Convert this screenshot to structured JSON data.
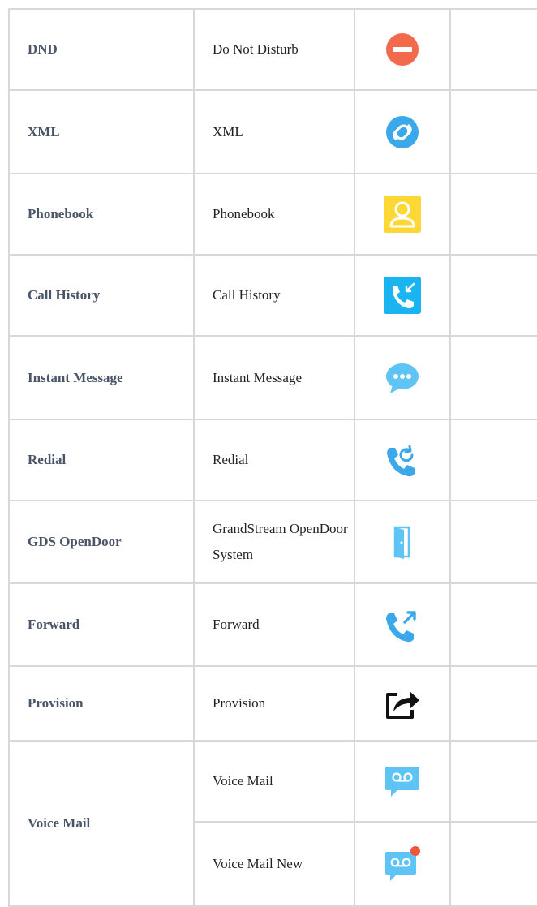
{
  "rows": [
    {
      "key": "DND",
      "description": "Do Not Disturb",
      "icon": "do-not-disturb-icon"
    },
    {
      "key": "XML",
      "description": "XML",
      "icon": "xml-link-icon"
    },
    {
      "key": "Phonebook",
      "description": "Phonebook",
      "icon": "phonebook-contact-icon"
    },
    {
      "key": "Call History",
      "description": "Call History",
      "icon": "call-history-icon"
    },
    {
      "key": "Instant Message",
      "description": "Instant Message",
      "icon": "chat-bubble-icon"
    },
    {
      "key": "Redial",
      "description": "Redial",
      "icon": "redial-icon"
    },
    {
      "key": "GDS OpenDoor",
      "description": "GrandStream OpenDoor System",
      "icon": "door-icon"
    },
    {
      "key": "Forward",
      "description": "Forward",
      "icon": "call-forward-icon"
    },
    {
      "key": "Provision",
      "description": "Provision",
      "icon": "share-arrow-icon"
    },
    {
      "key": "Voice Mail",
      "description": "Voice Mail",
      "icon": "voicemail-icon"
    },
    {
      "key": "",
      "description": "Voice Mail New",
      "icon": "voicemail-new-icon"
    }
  ],
  "colors": {
    "dnd_red": "#f26a4b",
    "icon_blue": "#3aa8ea",
    "icon_light_blue": "#5ec4f5",
    "phonebook_yellow": "#fdd835",
    "call_history_cyan": "#1ab5f0",
    "badge_red": "#f0553a",
    "key_text": "#4a5568",
    "border": "#d8d8d8"
  }
}
